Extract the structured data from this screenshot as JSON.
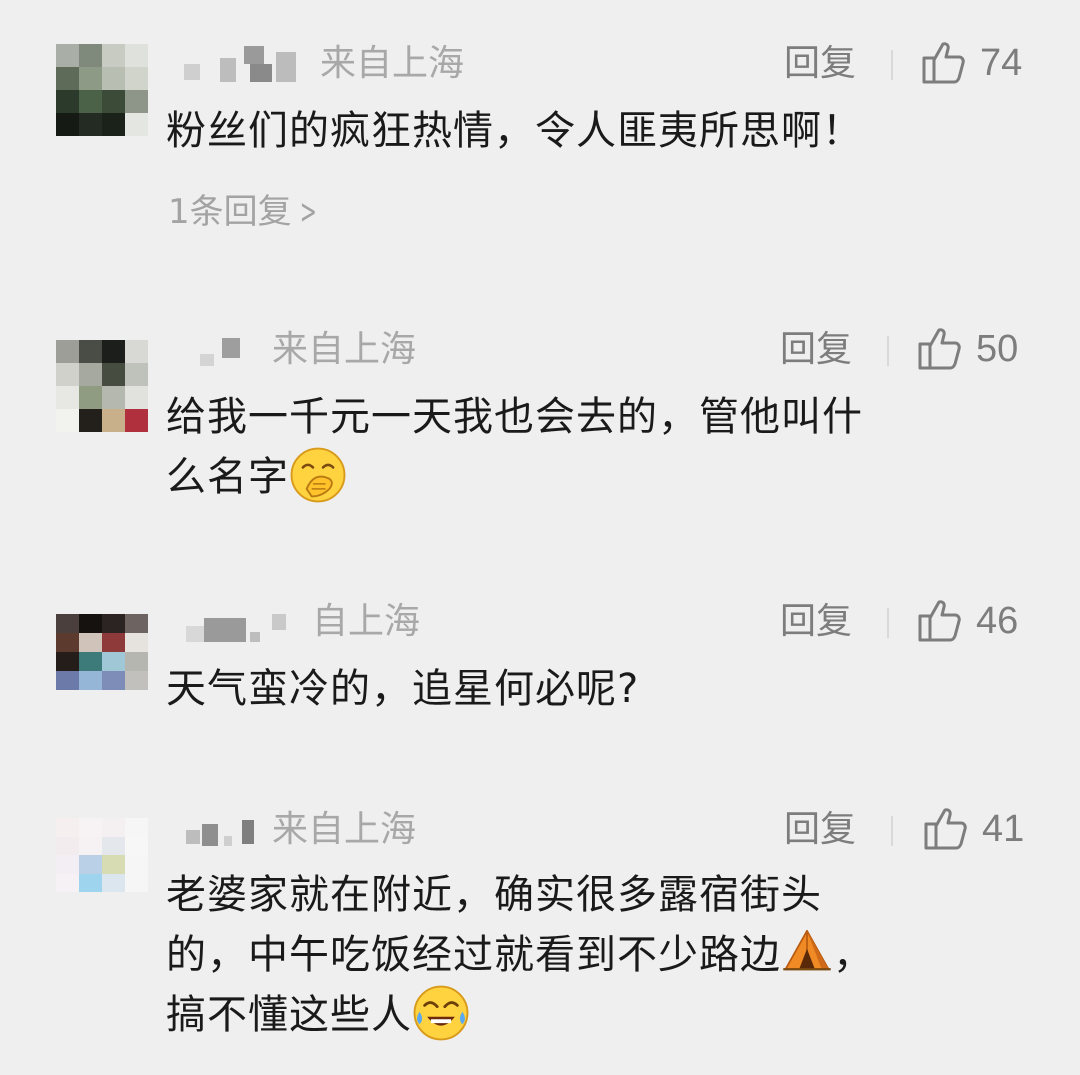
{
  "comments": [
    {
      "location": "来自上海",
      "reply_label": "回复",
      "likes": "74",
      "text": "粉丝们的疯狂热情，令人匪夷所思啊！",
      "sub_replies": "1条回复",
      "sub_replies_chevron": ">"
    },
    {
      "location": "来自上海",
      "reply_label": "回复",
      "likes": "50",
      "text_line1": "给我一千元一天我也会去的，管他叫什",
      "text_line2": "么名字",
      "emoji": "hand-over-mouth-emoji"
    },
    {
      "location": "自上海",
      "reply_label": "回复",
      "likes": "46",
      "text": "天气蛮冷的，追星何必呢?"
    },
    {
      "location": "来自上海",
      "reply_label": "回复",
      "likes": "41",
      "text_line1": "老婆家就在附近，确实很多露宿街头",
      "text_line2": "的，中午吃饭经过就看到不少路边",
      "text_line2_tail": "，",
      "text_line3": "搞不懂这些人",
      "emoji_tent": "tent-emoji",
      "emoji_laugh": "tears-of-joy-emoji"
    }
  ],
  "colors": {
    "background": "#efefef",
    "text": "#1a1a1a",
    "muted": "#a8a8a8",
    "action": "#7d7d7d"
  }
}
